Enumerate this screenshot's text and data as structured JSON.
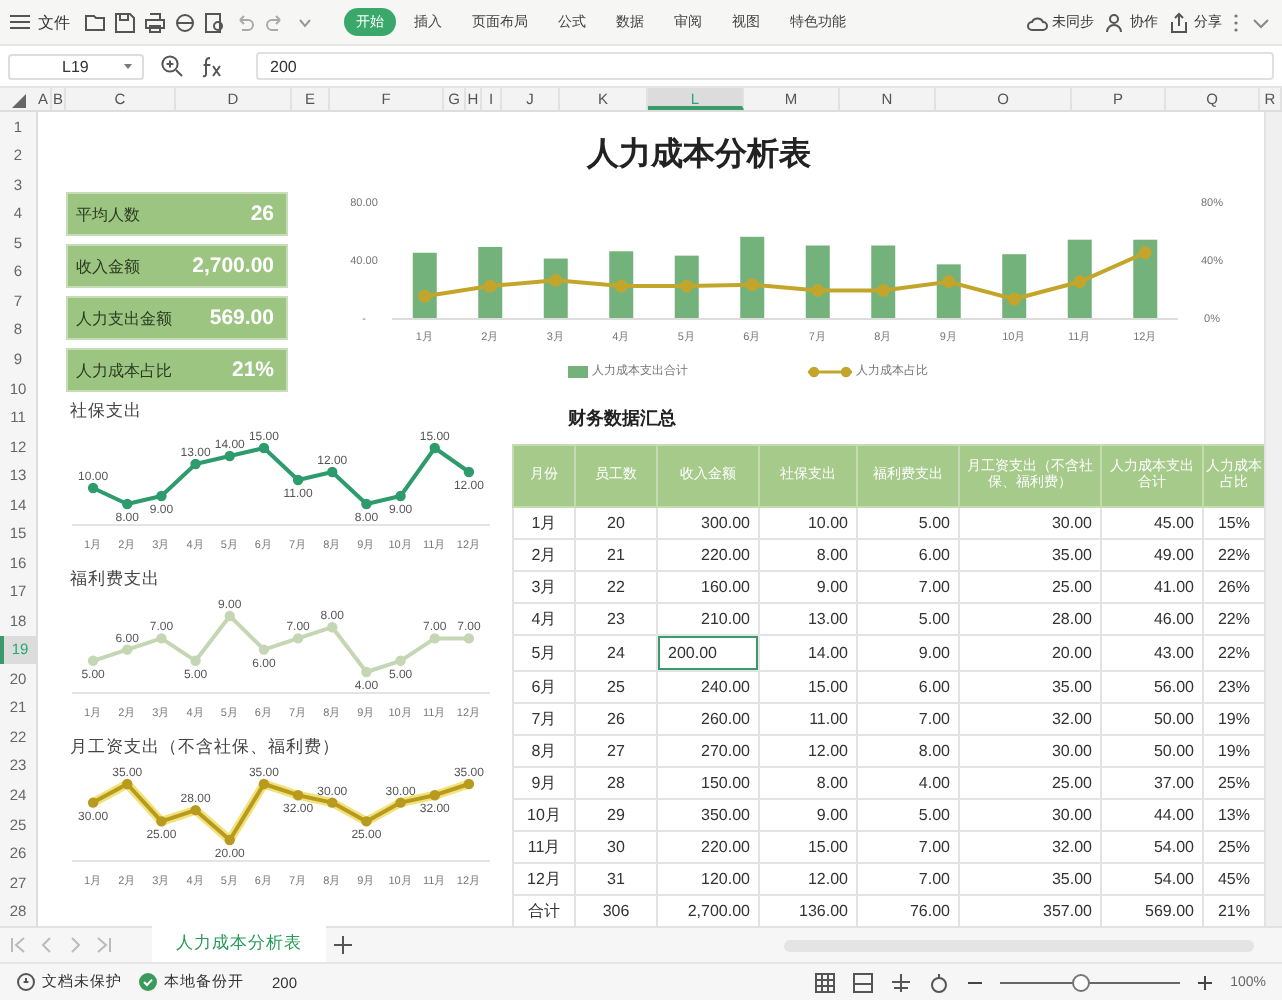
{
  "toolbar": {
    "menu_label": "文件",
    "tabs": [
      {
        "label": "开始",
        "selected": true
      },
      {
        "label": "插入",
        "selected": false
      },
      {
        "label": "页面布局",
        "selected": false
      },
      {
        "label": "公式",
        "selected": false
      },
      {
        "label": "数据",
        "selected": false
      },
      {
        "label": "审阅",
        "selected": false
      },
      {
        "label": "视图",
        "selected": false
      },
      {
        "label": "特色功能",
        "selected": false
      }
    ],
    "actions": [
      "未同步",
      "协作",
      "分享"
    ]
  },
  "formula_bar": {
    "cell_ref": "L19",
    "formula": "200"
  },
  "column_headers": [
    {
      "label": "A",
      "selected": false
    },
    {
      "label": "B",
      "selected": false
    },
    {
      "label": "C",
      "selected": false
    },
    {
      "label": "D",
      "selected": false
    },
    {
      "label": "E",
      "selected": false
    },
    {
      "label": "F",
      "selected": false
    },
    {
      "label": "G",
      "selected": false
    },
    {
      "label": "H",
      "selected": false
    },
    {
      "label": "I",
      "selected": false
    },
    {
      "label": "J",
      "selected": false
    },
    {
      "label": "K",
      "selected": false
    },
    {
      "label": "L",
      "selected": true
    },
    {
      "label": "M",
      "selected": false
    },
    {
      "label": "N",
      "selected": false
    },
    {
      "label": "O",
      "selected": false
    },
    {
      "label": "P",
      "selected": false
    },
    {
      "label": "Q",
      "selected": false
    },
    {
      "label": "R",
      "selected": false
    }
  ],
  "row_headers": [
    {
      "label": "1",
      "selected": false
    },
    {
      "label": "2",
      "selected": false
    },
    {
      "label": "3",
      "selected": false
    },
    {
      "label": "4",
      "selected": false
    },
    {
      "label": "5",
      "selected": false
    },
    {
      "label": "6",
      "selected": false
    },
    {
      "label": "7",
      "selected": false
    },
    {
      "label": "8",
      "selected": false
    },
    {
      "label": "9",
      "selected": false
    },
    {
      "label": "10",
      "selected": false
    },
    {
      "label": "11",
      "selected": false
    },
    {
      "label": "12",
      "selected": false
    },
    {
      "label": "13",
      "selected": false
    },
    {
      "label": "14",
      "selected": false
    },
    {
      "label": "15",
      "selected": false
    },
    {
      "label": "16",
      "selected": false
    },
    {
      "label": "17",
      "selected": false
    },
    {
      "label": "18",
      "selected": false
    },
    {
      "label": "19",
      "selected": true
    },
    {
      "label": "20",
      "selected": false
    },
    {
      "label": "21",
      "selected": false
    },
    {
      "label": "22",
      "selected": false
    },
    {
      "label": "23",
      "selected": false
    },
    {
      "label": "24",
      "selected": false
    },
    {
      "label": "25",
      "selected": false
    },
    {
      "label": "26",
      "selected": false
    },
    {
      "label": "27",
      "selected": false
    },
    {
      "label": "28",
      "selected": false
    }
  ],
  "sheet": {
    "title": "人力成本分析表",
    "kpis": [
      {
        "label": "平均人数",
        "value": "26"
      },
      {
        "label": "收入金额",
        "value": "2,700.00"
      },
      {
        "label": "人力支出金额",
        "value": "569.00"
      },
      {
        "label": "人力成本占比",
        "value": "21%"
      }
    ],
    "cost_chart": {
      "chart_data": {
        "type": "bar",
        "categories": [
          "1月",
          "2月",
          "3月",
          "4月",
          "5月",
          "6月",
          "7月",
          "8月",
          "9月",
          "10月",
          "11月",
          "12月"
        ],
        "series": [
          {
            "name": "人力成本支出合计",
            "color": "#74b27c",
            "type": "bar",
            "values": [
              45,
              49,
              41,
              46,
              43,
              56,
              50,
              50,
              37,
              44,
              54,
              54
            ]
          },
          {
            "name": "人力成本占比",
            "color": "#c4a52c",
            "type": "line",
            "marker": true,
            "values": [
              15,
              22,
              26,
              22,
              22,
              23,
              19,
              19,
              25,
              13,
              25,
              45
            ]
          }
        ],
        "ylim": [
          0,
          80
        ],
        "yticks": [
          {
            "value": 0,
            "label": "-"
          },
          {
            "value": 40,
            "label": "40.00"
          },
          {
            "value": 80,
            "label": "80.00"
          }
        ],
        "legend": "bottom",
        "y2lim": [
          0,
          80
        ],
        "y2ticks": [
          {
            "value": 0,
            "label": "0%"
          },
          {
            "value": 40,
            "label": "40%"
          },
          {
            "value": 80,
            "label": "80%"
          }
        ]
      }
    },
    "mini_charts": [
      {
        "chart_data": {
          "type": "line",
          "title": "社保支出",
          "categories": [
            "1月",
            "2月",
            "3月",
            "4月",
            "5月",
            "6月",
            "7月",
            "8月",
            "9月",
            "10月",
            "11月",
            "12月"
          ],
          "series": [
            {
              "color": "#2e9b6c",
              "marker": true,
              "values": [
                10,
                8,
                9,
                13,
                14,
                15,
                11,
                12,
                8,
                9,
                15,
                12
              ],
              "value_labels": [
                "10.00",
                "8.00",
                "9.00",
                "13.00",
                "14.00",
                "15.00",
                "11.00",
                "12.00",
                "8.00",
                "9.00",
                "15.00",
                "12.00"
              ]
            }
          ]
        }
      },
      {
        "chart_data": {
          "type": "line",
          "title": "福利费支出",
          "categories": [
            "1月",
            "2月",
            "3月",
            "4月",
            "5月",
            "6月",
            "7月",
            "8月",
            "9月",
            "10月",
            "11月",
            "12月"
          ],
          "series": [
            {
              "color": "#c5d6b4",
              "marker": true,
              "values": [
                5,
                6,
                7,
                5,
                9,
                6,
                7,
                8,
                4,
                5,
                7,
                7
              ],
              "value_labels": [
                "5.00",
                "6.00",
                "7.00",
                "5.00",
                "9.00",
                "6.00",
                "7.00",
                "8.00",
                "4.00",
                "5.00",
                "7.00",
                "7.00"
              ]
            }
          ]
        }
      },
      {
        "chart_data": {
          "type": "line",
          "title": "月工资支出（不含社保、福利费）",
          "categories": [
            "1月",
            "2月",
            "3月",
            "4月",
            "5月",
            "6月",
            "7月",
            "8月",
            "9月",
            "10月",
            "11月",
            "12月"
          ],
          "series": [
            {
              "color": "#b89a1e",
              "marker": true,
              "values": [
                30,
                35,
                25,
                28,
                20,
                35,
                32,
                30,
                25,
                30,
                32,
                35
              ],
              "value_labels": [
                "30.00",
                "35.00",
                "25.00",
                "28.00",
                "20.00",
                "35.00",
                "32.00",
                "30.00",
                "25.00",
                "30.00",
                "32.00",
                "35.00"
              ]
            }
          ]
        }
      }
    ],
    "table": {
      "title": "财务数据汇总",
      "columns": [
        "月份",
        "员工数",
        "收入金额",
        "社保支出",
        "福利费支出",
        "月工资支出（不含社保、福利费）",
        "人力成本支出合计",
        "人力成本占比"
      ],
      "rows": [
        [
          {
            "text": "1月",
            "selected": false
          },
          {
            "text": "20",
            "selected": false
          },
          {
            "text": "300.00",
            "selected": false
          },
          {
            "text": "10.00",
            "selected": false
          },
          {
            "text": "5.00",
            "selected": false
          },
          {
            "text": "30.00",
            "selected": false
          },
          {
            "text": "45.00",
            "selected": false
          },
          {
            "text": "15%",
            "selected": false
          }
        ],
        [
          {
            "text": "2月",
            "selected": false
          },
          {
            "text": "21",
            "selected": false
          },
          {
            "text": "220.00",
            "selected": false
          },
          {
            "text": "8.00",
            "selected": false
          },
          {
            "text": "6.00",
            "selected": false
          },
          {
            "text": "35.00",
            "selected": false
          },
          {
            "text": "49.00",
            "selected": false
          },
          {
            "text": "22%",
            "selected": false
          }
        ],
        [
          {
            "text": "3月",
            "selected": false
          },
          {
            "text": "22",
            "selected": false
          },
          {
            "text": "160.00",
            "selected": false
          },
          {
            "text": "9.00",
            "selected": false
          },
          {
            "text": "7.00",
            "selected": false
          },
          {
            "text": "25.00",
            "selected": false
          },
          {
            "text": "41.00",
            "selected": false
          },
          {
            "text": "26%",
            "selected": false
          }
        ],
        [
          {
            "text": "4月",
            "selected": false
          },
          {
            "text": "23",
            "selected": false
          },
          {
            "text": "210.00",
            "selected": false
          },
          {
            "text": "13.00",
            "selected": false
          },
          {
            "text": "5.00",
            "selected": false
          },
          {
            "text": "28.00",
            "selected": false
          },
          {
            "text": "46.00",
            "selected": false
          },
          {
            "text": "22%",
            "selected": false
          }
        ],
        [
          {
            "text": "5月",
            "selected": false
          },
          {
            "text": "24",
            "selected": false
          },
          {
            "text": "200.00",
            "selected": true
          },
          {
            "text": "14.00",
            "selected": false
          },
          {
            "text": "9.00",
            "selected": false
          },
          {
            "text": "20.00",
            "selected": false
          },
          {
            "text": "43.00",
            "selected": false
          },
          {
            "text": "22%",
            "selected": false
          }
        ],
        [
          {
            "text": "6月",
            "selected": false
          },
          {
            "text": "25",
            "selected": false
          },
          {
            "text": "240.00",
            "selected": false
          },
          {
            "text": "15.00",
            "selected": false
          },
          {
            "text": "6.00",
            "selected": false
          },
          {
            "text": "35.00",
            "selected": false
          },
          {
            "text": "56.00",
            "selected": false
          },
          {
            "text": "23%",
            "selected": false
          }
        ],
        [
          {
            "text": "7月",
            "selected": false
          },
          {
            "text": "26",
            "selected": false
          },
          {
            "text": "260.00",
            "selected": false
          },
          {
            "text": "11.00",
            "selected": false
          },
          {
            "text": "7.00",
            "selected": false
          },
          {
            "text": "32.00",
            "selected": false
          },
          {
            "text": "50.00",
            "selected": false
          },
          {
            "text": "19%",
            "selected": false
          }
        ],
        [
          {
            "text": "8月",
            "selected": false
          },
          {
            "text": "27",
            "selected": false
          },
          {
            "text": "270.00",
            "selected": false
          },
          {
            "text": "12.00",
            "selected": false
          },
          {
            "text": "8.00",
            "selected": false
          },
          {
            "text": "30.00",
            "selected": false
          },
          {
            "text": "50.00",
            "selected": false
          },
          {
            "text": "19%",
            "selected": false
          }
        ],
        [
          {
            "text": "9月",
            "selected": false
          },
          {
            "text": "28",
            "selected": false
          },
          {
            "text": "150.00",
            "selected": false
          },
          {
            "text": "8.00",
            "selected": false
          },
          {
            "text": "4.00",
            "selected": false
          },
          {
            "text": "25.00",
            "selected": false
          },
          {
            "text": "37.00",
            "selected": false
          },
          {
            "text": "25%",
            "selected": false
          }
        ],
        [
          {
            "text": "10月",
            "selected": false
          },
          {
            "text": "29",
            "selected": false
          },
          {
            "text": "350.00",
            "selected": false
          },
          {
            "text": "9.00",
            "selected": false
          },
          {
            "text": "5.00",
            "selected": false
          },
          {
            "text": "30.00",
            "selected": false
          },
          {
            "text": "44.00",
            "selected": false
          },
          {
            "text": "13%",
            "selected": false
          }
        ],
        [
          {
            "text": "11月",
            "selected": false
          },
          {
            "text": "30",
            "selected": false
          },
          {
            "text": "220.00",
            "selected": false
          },
          {
            "text": "15.00",
            "selected": false
          },
          {
            "text": "7.00",
            "selected": false
          },
          {
            "text": "32.00",
            "selected": false
          },
          {
            "text": "54.00",
            "selected": false
          },
          {
            "text": "25%",
            "selected": false
          }
        ],
        [
          {
            "text": "12月",
            "selected": false
          },
          {
            "text": "31",
            "selected": false
          },
          {
            "text": "120.00",
            "selected": false
          },
          {
            "text": "12.00",
            "selected": false
          },
          {
            "text": "7.00",
            "selected": false
          },
          {
            "text": "35.00",
            "selected": false
          },
          {
            "text": "54.00",
            "selected": false
          },
          {
            "text": "45%",
            "selected": false
          }
        ],
        [
          {
            "text": "合计",
            "selected": false
          },
          {
            "text": "306",
            "selected": false
          },
          {
            "text": "2,700.00",
            "selected": false
          },
          {
            "text": "136.00",
            "selected": false
          },
          {
            "text": "76.00",
            "selected": false
          },
          {
            "text": "357.00",
            "selected": false
          },
          {
            "text": "569.00",
            "selected": false
          },
          {
            "text": "21%",
            "selected": false
          }
        ]
      ]
    }
  },
  "sheet_tabs": [
    {
      "label": "人力成本分析表",
      "selected": true
    }
  ],
  "status_bar": {
    "protection": "文档未保护",
    "backup": "本地备份开",
    "cell_value": "200",
    "zoom": {
      "level": 0.45,
      "label": "100%"
    }
  }
}
